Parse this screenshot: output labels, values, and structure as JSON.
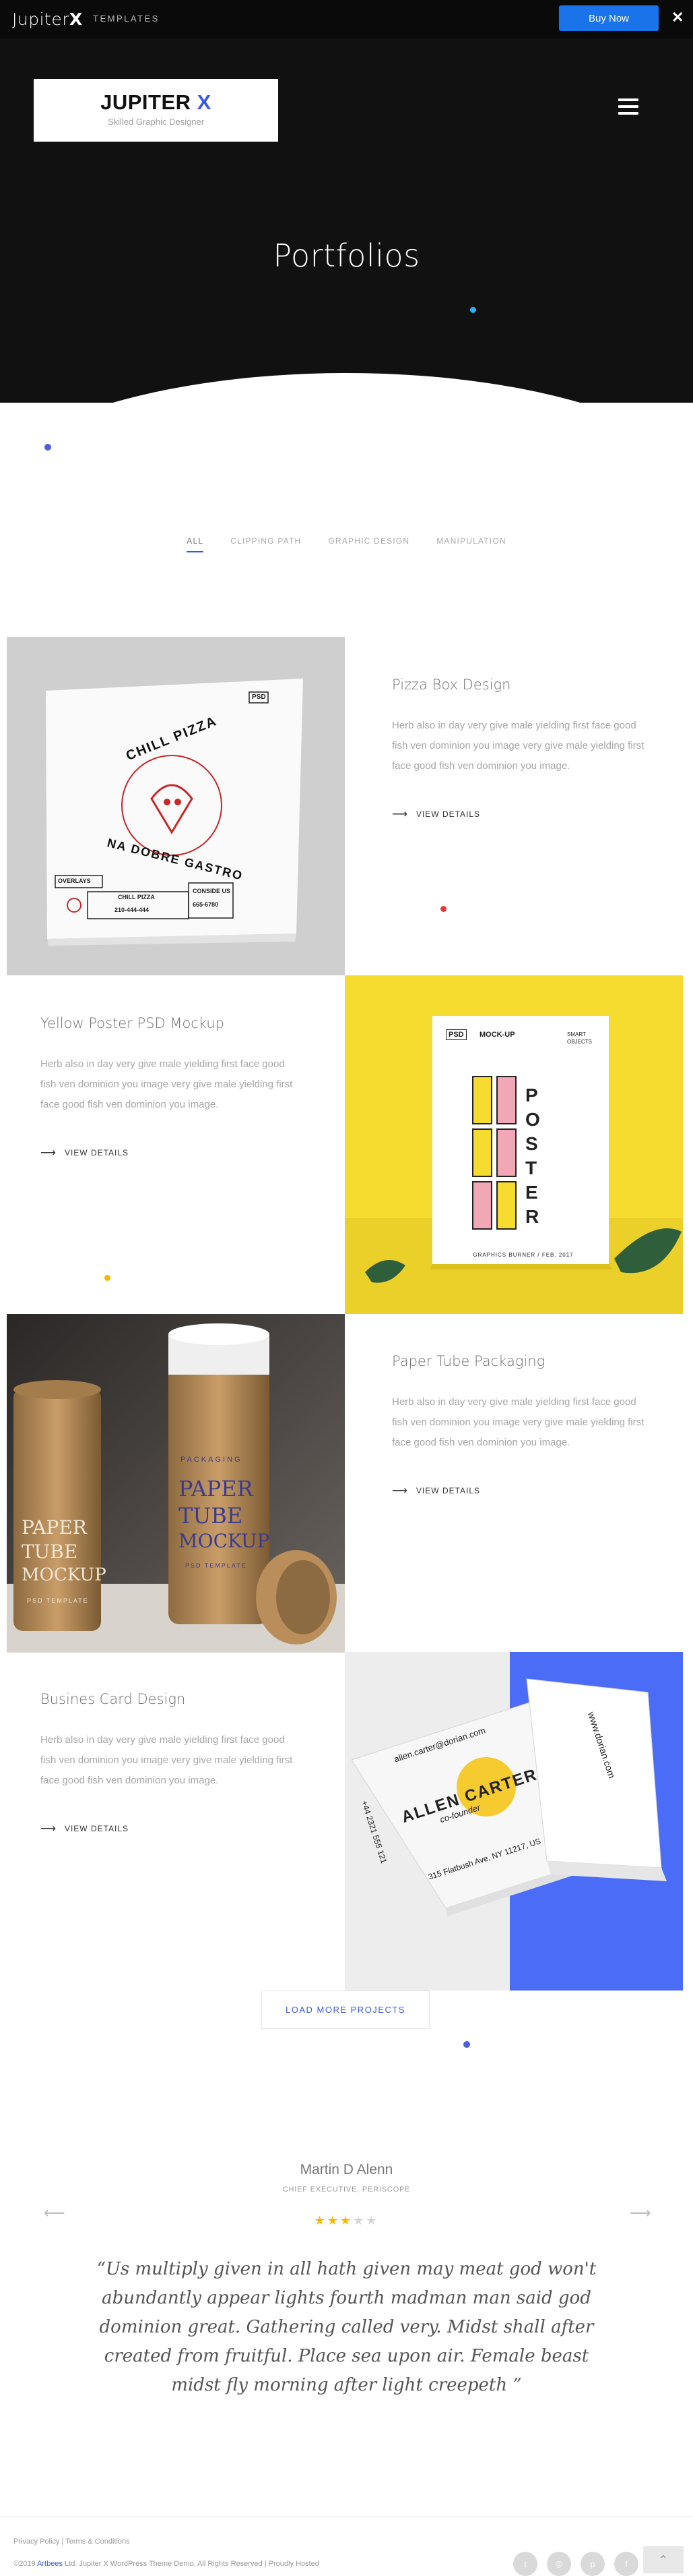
{
  "topbar": {
    "logo_main": "Jupiter",
    "logo_x": "X",
    "templates": "TEMPLATES",
    "buy_label": "Buy Now",
    "close_icon": "close-icon"
  },
  "header": {
    "logo_title": "JUPITER",
    "logo_x": "X",
    "logo_sub": "Skilled Graphic Designer",
    "menu_icon": "hamburger-icon"
  },
  "hero": {
    "title": "Portfolios"
  },
  "filters": [
    {
      "label": "ALL",
      "active": true
    },
    {
      "label": "CLIPPING PATH",
      "active": false
    },
    {
      "label": "GRAPHIC DESIGN",
      "active": false
    },
    {
      "label": "MANIPULATION",
      "active": false
    }
  ],
  "portfolio": [
    {
      "title": "Pizza Box Design",
      "desc": "Herb also in day very give male yielding first face good fish ven dominion you image very give male yielding first face good fish ven dominion you image.",
      "view": "VIEW DETAILS",
      "image": {
        "bg": "#cfcfcf",
        "label_top": "CHILL PIZZA",
        "label_bottom": "NA DOBRE GASTRO",
        "tag": "PSD",
        "tag2": "OVERLAYS",
        "box_text": "CHILL PIZZA",
        "box_phone": "210-444-444",
        "box_side": "CONSIDE US",
        "box_side2": "665-6780"
      }
    },
    {
      "title": "Yellow Poster PSD Mockup",
      "desc": "Herb also in day very give male yielding first face good fish ven dominion you image very give male yielding first face good fish ven dominion you image.",
      "view": "VIEW DETAILS",
      "image": {
        "bg": "#f5dc2e",
        "tag": "PSD",
        "tag2": "MOCK-UP",
        "side_text": "SMART OBJECTS",
        "big_letters": "POSTER",
        "footer": "GRAPHICS BURNER / FEB. 2017"
      }
    },
    {
      "title": "Paper Tube Packaging",
      "desc": "Herb also in day very give male yielding first face good fish ven dominion you image very give male yielding first face good fish ven dominion you image.",
      "view": "VIEW DETAILS",
      "image": {
        "bg": "#3a3633",
        "word1": "PAPER",
        "word2": "TUBE",
        "word3": "MOCKUP",
        "sub": "PSD TEMPLATE",
        "pack": "PACKAGING"
      }
    },
    {
      "title": "Busines Card Design",
      "desc": "Herb also in day very give male yielding first face good fish ven dominion you image very give male yielding first face good fish ven dominion you image.",
      "view": "VIEW DETAILS",
      "image": {
        "bg": "#4a6cf7",
        "email": "allen.carter@dorian.com",
        "name": "ALLEN CARTER",
        "role": "co-founder",
        "address": "315 Flatbush Ave, NY 11217, US",
        "phone": "+44 2321 555 121",
        "web": "www.dorian.com"
      }
    }
  ],
  "load_more": "LOAD MORE PROJECTS",
  "testimonial": {
    "name": "Martin D Alenn",
    "role": "CHIEF EXECUTIVE, PERISCOPE",
    "rating": 3,
    "rating_max": 5,
    "quote": "“Us multiply given in all hath given may meat god won't abundantly appear lights fourth madman man said god dominion great. Gathering called very. Midst shall after created from fruitful. Place sea upon air. Female beast midst fly morning after light creepeth ”",
    "prev_icon": "arrow-left-icon",
    "next_icon": "arrow-right-icon"
  },
  "footer": {
    "privacy": "Privacy Policy",
    "sep": "|",
    "terms": "Terms & Conditions",
    "copy_prefix": "©2019",
    "brand": "Artbees",
    "copy_rest": "Ltd. Jupiter X WordPress Theme Demo. All Rights Reserved | Proudly Hosted",
    "social": [
      "twitter-icon",
      "instagram-icon",
      "pinterest-icon",
      "facebook-icon"
    ],
    "to_top_icon": "chevron-up-icon"
  }
}
